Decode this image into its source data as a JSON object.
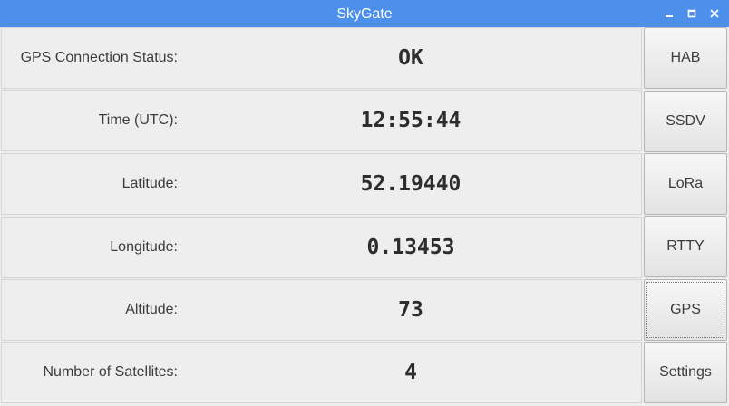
{
  "window": {
    "title": "SkyGate",
    "controls": [
      "minimize-icon",
      "maximize-icon",
      "close-icon"
    ],
    "titlebar_color": "#4d90ec"
  },
  "status_rows": [
    {
      "label": "GPS Connection Status:",
      "value": "OK"
    },
    {
      "label": "Time (UTC):",
      "value": "12:55:44"
    },
    {
      "label": "Latitude:",
      "value": "52.19440"
    },
    {
      "label": "Longitude:",
      "value": "0.13453"
    },
    {
      "label": "Altitude:",
      "value": "73"
    },
    {
      "label": "Number of Satellites:",
      "value": "4"
    }
  ],
  "nav_buttons": [
    {
      "label": "HAB"
    },
    {
      "label": "SSDV"
    },
    {
      "label": "LoRa"
    },
    {
      "label": "RTTY"
    },
    {
      "label": "GPS",
      "focused": true
    },
    {
      "label": "Settings"
    }
  ]
}
